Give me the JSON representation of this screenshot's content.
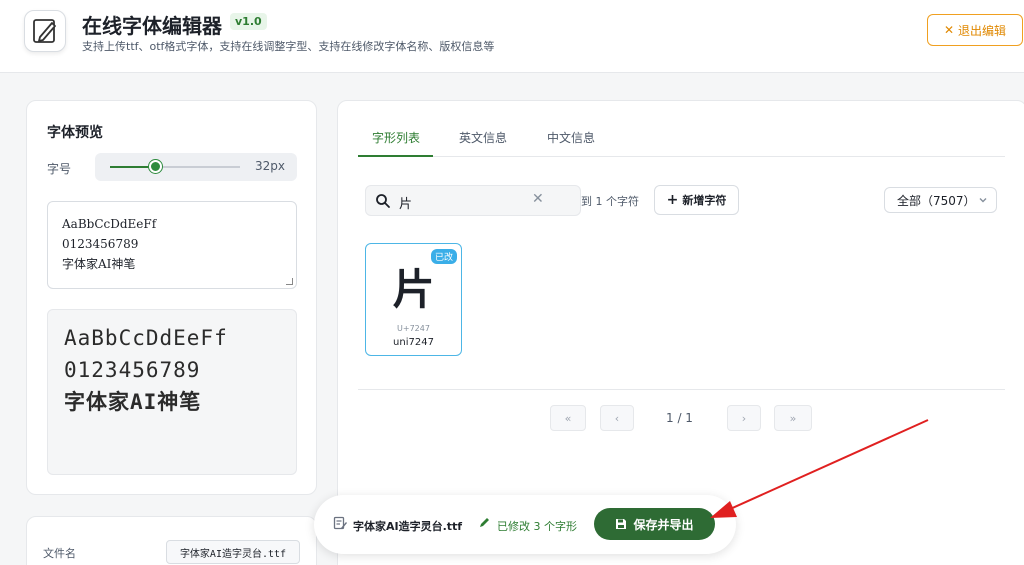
{
  "header": {
    "title": "在线字体编辑器",
    "version": "v1.0",
    "subtitle": "支持上传ttf、otf格式字体，支持在线调整字型、支持在线修改字体名称、版权信息等",
    "exit_label": "退出编辑"
  },
  "preview": {
    "title": "字体预览",
    "size_label": "字号",
    "size_value": "32px",
    "size_fraction": 0.35,
    "input_lines": [
      "AaBbCcDdEeFf",
      "0123456789",
      "字体家AI神笔"
    ],
    "output_lines": [
      "AaBbCcDdEeFf",
      "0123456789",
      "字体家AI神笔"
    ]
  },
  "file_info": {
    "label": "文件名",
    "value": "字体家AI造字灵台.ttf"
  },
  "tabs": [
    {
      "label": "字形列表",
      "active": true
    },
    {
      "label": "英文信息",
      "active": false
    },
    {
      "label": "中文信息",
      "active": false
    }
  ],
  "toolbar": {
    "search_value": "片",
    "result_text": "到 1 个字符",
    "add_label": "新增字符",
    "filter_value": "全部（7507）"
  },
  "glyphs": [
    {
      "char": "片",
      "badge": "已改",
      "code": "U+7247",
      "name": "uni7247"
    }
  ],
  "pagination": {
    "first": "«",
    "prev": "‹",
    "info": "1 / 1",
    "next": "›",
    "last": "»"
  },
  "save_bar": {
    "file": "字体家AI造字灵台.ttf",
    "modified": "已修改 3 个字形",
    "save_label": "保存并导出"
  },
  "colors": {
    "accent": "#2e7d32",
    "exit": "#e08800",
    "badge": "#3aaee8",
    "annotation_arrow": "#e02020"
  }
}
